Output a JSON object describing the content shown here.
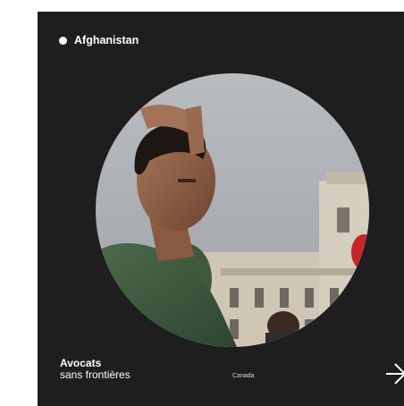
{
  "card": {
    "country": "Afghanistan",
    "organization": {
      "line1": "Avocats",
      "line2": "sans frontières"
    },
    "location": "Canada"
  },
  "colors": {
    "card_background": "#1e1e1e",
    "text": "#ffffff",
    "accent_dot": "#ffffff"
  },
  "icons": {
    "status": "dot-icon",
    "next": "arrow-right-icon"
  }
}
